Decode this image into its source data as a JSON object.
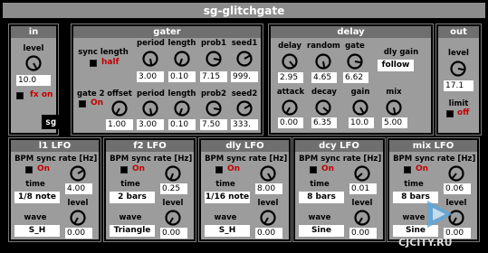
{
  "title": "sg-glitchgate",
  "logo_text": "sg",
  "watermark": "CJCITY.RU",
  "in": {
    "title": "in",
    "level_label": "level",
    "level_value": "10.0",
    "fx_label": "fx on"
  },
  "gater": {
    "title": "gater",
    "sync_length_label": "sync length",
    "sync_length_state": "half",
    "period_label": "period",
    "period_value": "3.00",
    "length_label": "length",
    "length_value": "0.10",
    "prob1_label": "prob1",
    "prob1_value": "7.15",
    "seed1_label": "seed1",
    "seed1_value": "999.",
    "gate2_label": "gate 2",
    "gate2_state": "On",
    "offset_label": "offset",
    "offset_value": "1.00",
    "period2_label": "period",
    "period2_value": "3.00",
    "length2_label": "length",
    "length2_value": "0.10",
    "prob2_label": "prob2",
    "prob2_value": "7.50",
    "seed2_label": "seed2",
    "seed2_value": "333."
  },
  "delay": {
    "title": "delay",
    "delay_label": "delay",
    "delay_value": "2.95",
    "random_label": "random",
    "random_value": "4.65",
    "gate_label": "gate",
    "gate_value": "6.62",
    "dly_gain_label": "dly gain",
    "dly_gain_value": "follow",
    "attack_label": "attack",
    "attack_value": "0.00",
    "decay_label": "decay",
    "decay_value": "6.35",
    "gain_label": "gain",
    "gain_value": "10.0",
    "mix_label": "mix",
    "mix_value": "5.00"
  },
  "out": {
    "title": "out",
    "level_label": "level",
    "level_value": "17.1",
    "limit_label": "limit",
    "limit_state": "off"
  },
  "lfos": [
    {
      "title": "l1 LFO",
      "bpm_sync_label": "BPM sync",
      "bpm_state": "On",
      "rate_label": "rate [Hz]",
      "rate_value": "4.00",
      "time_label": "time",
      "time_value": "1/8 note",
      "level_label": "level",
      "level_value": "0.00",
      "wave_label": "wave",
      "wave_value": "S_H"
    },
    {
      "title": "f2 LFO",
      "bpm_sync_label": "BPM sync",
      "bpm_state": "On",
      "rate_label": "rate [Hz]",
      "rate_value": "0.25",
      "time_label": "time",
      "time_value": "2 bars",
      "level_label": "level",
      "level_value": "0.00",
      "wave_label": "wave",
      "wave_value": "Triangle"
    },
    {
      "title": "dly LFO",
      "bpm_sync_label": "BPM sync",
      "bpm_state": "On",
      "rate_label": "rate [Hz]",
      "rate_value": "8.00",
      "time_label": "time",
      "time_value": "1/16 note",
      "level_label": "level",
      "level_value": "0.00",
      "wave_label": "wave",
      "wave_value": "S_H"
    },
    {
      "title": "dcy LFO",
      "bpm_sync_label": "BPM sync",
      "bpm_state": "On",
      "rate_label": "rate [Hz]",
      "rate_value": "0.01",
      "time_label": "time",
      "time_value": "8 bars",
      "level_label": "level",
      "level_value": "0.00",
      "wave_label": "wave",
      "wave_value": "Sine"
    },
    {
      "title": "mix LFO",
      "bpm_sync_label": "BPM sync",
      "bpm_state": "On",
      "rate_label": "rate [Hz]",
      "rate_value": "0.06",
      "time_label": "time",
      "time_value": "8 bars",
      "level_label": "level",
      "level_value": "0.00",
      "wave_label": "wave",
      "wave_value": "Sine"
    }
  ],
  "colors": {
    "panel": "#9c9c9c",
    "header": "#6f6f6f",
    "accent_red": "#c40000"
  }
}
